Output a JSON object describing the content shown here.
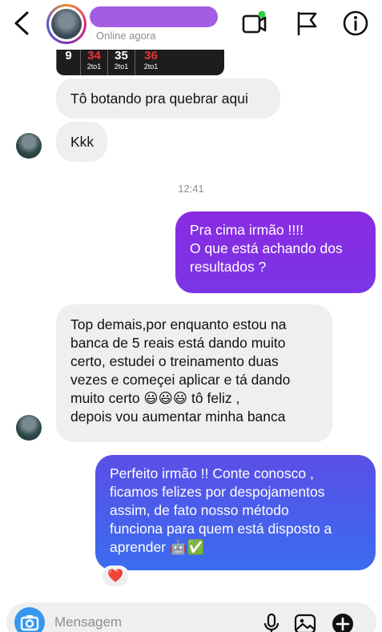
{
  "header": {
    "status": "Online agora",
    "icons": {
      "back": "chevron-left-icon",
      "video": "video-call-icon",
      "flag": "flag-icon",
      "info": "info-icon"
    },
    "online_color": "#2ecc40"
  },
  "image_preview": {
    "cells": [
      {
        "num": "9",
        "label": "",
        "red": false
      },
      {
        "num": "34",
        "label": "2to1",
        "red": true
      },
      {
        "num": "35",
        "label": "2to1",
        "red": false
      },
      {
        "num": "36",
        "label": "2to1",
        "red": true
      }
    ]
  },
  "messages": [
    {
      "id": "m1",
      "side": "received",
      "text": "Tô botando pra quebrar aqui"
    },
    {
      "id": "m2",
      "side": "received",
      "text": "Kkk"
    },
    {
      "id": "m3",
      "side": "sent",
      "lines": [
        "Pra cima irmão !!!!",
        "O que está achando dos",
        "resultados ?"
      ]
    },
    {
      "id": "m4",
      "side": "received",
      "lines": [
        "Top demais,por enquanto estou na",
        "banca de 5 reais  está dando muito",
        "certo, estudei o treinamento duas",
        "vezes e começei aplicar e tá dando",
        "muito certo 😃😃😃 tô feliz  ,",
        "depois vou aumentar minha banca"
      ]
    },
    {
      "id": "m5",
      "side": "sent",
      "lines": [
        "Perfeito irmão !! Conte conosco ,",
        "ficamos felizes por despojamentos",
        "assim, de fato nosso método",
        "funciona para quem está disposto a",
        "aprender 🤖✅"
      ],
      "reaction": "❤️"
    }
  ],
  "timestamp": "12:41",
  "colors": {
    "sent_gradient_top": "#8a2be2",
    "sent_gradient_mid": "#6a3be8",
    "sent_gradient_bottom": "#3b6cf0",
    "received_bg": "#efefef",
    "camera_bg": "#3797f0"
  },
  "composer": {
    "placeholder": "Mensagem",
    "icons": {
      "camera": "camera-icon",
      "mic": "microphone-icon",
      "gallery": "gallery-icon",
      "plus": "plus-circle-icon"
    }
  }
}
